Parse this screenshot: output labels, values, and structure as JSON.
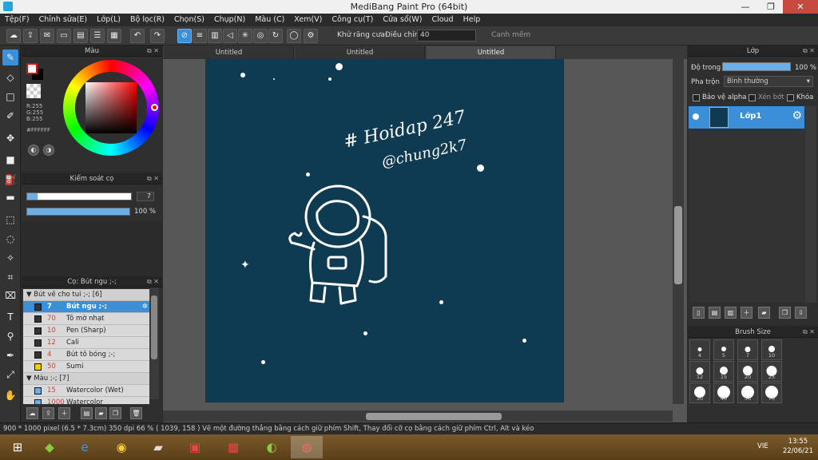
{
  "window": {
    "title": "MediBang Paint Pro (64bit)",
    "minimize": "—",
    "maximize": "❐",
    "close": "✕"
  },
  "menu": [
    "Tệp(F)",
    "Chỉnh sửa(E)",
    "Lớp(L)",
    "Bộ lọc(R)",
    "Chọn(S)",
    "Chụp(N)",
    "Màu (C)",
    "Xem(V)",
    "Công cụ(T)",
    "Cửa sổ(W)",
    "Cloud",
    "Help"
  ],
  "toolbar": {
    "antialias_label": "Khử răng cưa",
    "antialias_checked": true,
    "adjust_label": "Điều chỉnh",
    "adjust_value": "40",
    "soft_edge_label": "Canh mềm",
    "soft_edge_checked": false
  },
  "tabs": [
    "Untitled",
    "Untitled",
    "Untitled"
  ],
  "active_tab": 2,
  "color_panel": {
    "title": "Màu",
    "r": "R:255",
    "g": "G:255",
    "b": "B:255",
    "hex": "#FFFFFF",
    "foreground": "#FFFFFF",
    "background": "#000000"
  },
  "brush_control": {
    "title": "Kiểm soát cọ",
    "size_value": "7",
    "size_fraction": 0.1,
    "opacity_label": "100 %",
    "opacity_fraction": 1.0
  },
  "brush_panel": {
    "title": "Cọ: Bút ngu ;-;",
    "rows": [
      {
        "type": "group",
        "text": "▼  Bút vẽ cho tui ;-; [6]"
      },
      {
        "type": "item",
        "size": "7",
        "name": "Bút ngu ;-;",
        "selected": true,
        "swatch": "#333333"
      },
      {
        "type": "item",
        "size": "70",
        "name": "Tô mờ nhạt",
        "swatch": "#333333"
      },
      {
        "type": "item",
        "size": "10",
        "name": "Pen (Sharp)",
        "swatch": "#333333"
      },
      {
        "type": "item",
        "size": "12",
        "name": "Cali",
        "swatch": "#333333"
      },
      {
        "type": "item",
        "size": "4",
        "name": "Bút tô bóng ;-;",
        "swatch": "#333333"
      },
      {
        "type": "item",
        "size": "50",
        "name": "Sumi",
        "swatch": "#f0d000"
      },
      {
        "type": "group",
        "text": "▼  Màu ;-; [7]"
      },
      {
        "type": "item",
        "size": "15",
        "name": "Watercolor (Wet)",
        "swatch": "#6ab0e8"
      },
      {
        "type": "item",
        "size": "1000",
        "name": "Watercolor",
        "swatch": "#6ab0e8"
      }
    ]
  },
  "canvas": {
    "background": "#0e3a52",
    "hashtag": "# Hoidap 247",
    "handle": "@chung2k7"
  },
  "layer_panel": {
    "title": "Lớp",
    "opacity_label": "Độ trong",
    "opacity_value": "100 %",
    "blend_label": "Pha trộn",
    "blend_value": "Bình thường",
    "protect_alpha": "Bảo vệ alpha",
    "clipping": "Xén bớt",
    "lock": "Khóa",
    "layer_name": "Lớp1"
  },
  "brush_size_panel": {
    "title": "Brush Size",
    "sizes": [
      "3",
      "4",
      "5",
      "7",
      "10",
      "12",
      "15",
      "20",
      "25",
      "30",
      "40",
      "50",
      "70"
    ]
  },
  "status": {
    "text": "900 * 1000 pixel   (6.5 * 7.3cm)   350 dpi   66 %   ( 1039, 158 )   Vẽ một đường thẳng bằng cách giữ phím Shift, Thay đổi cỡ cọ bằng cách giữ phím Ctrl, Alt và kéo"
  },
  "taskbar": {
    "language": "VIE",
    "time": "13:55",
    "date": "22/06/21"
  }
}
